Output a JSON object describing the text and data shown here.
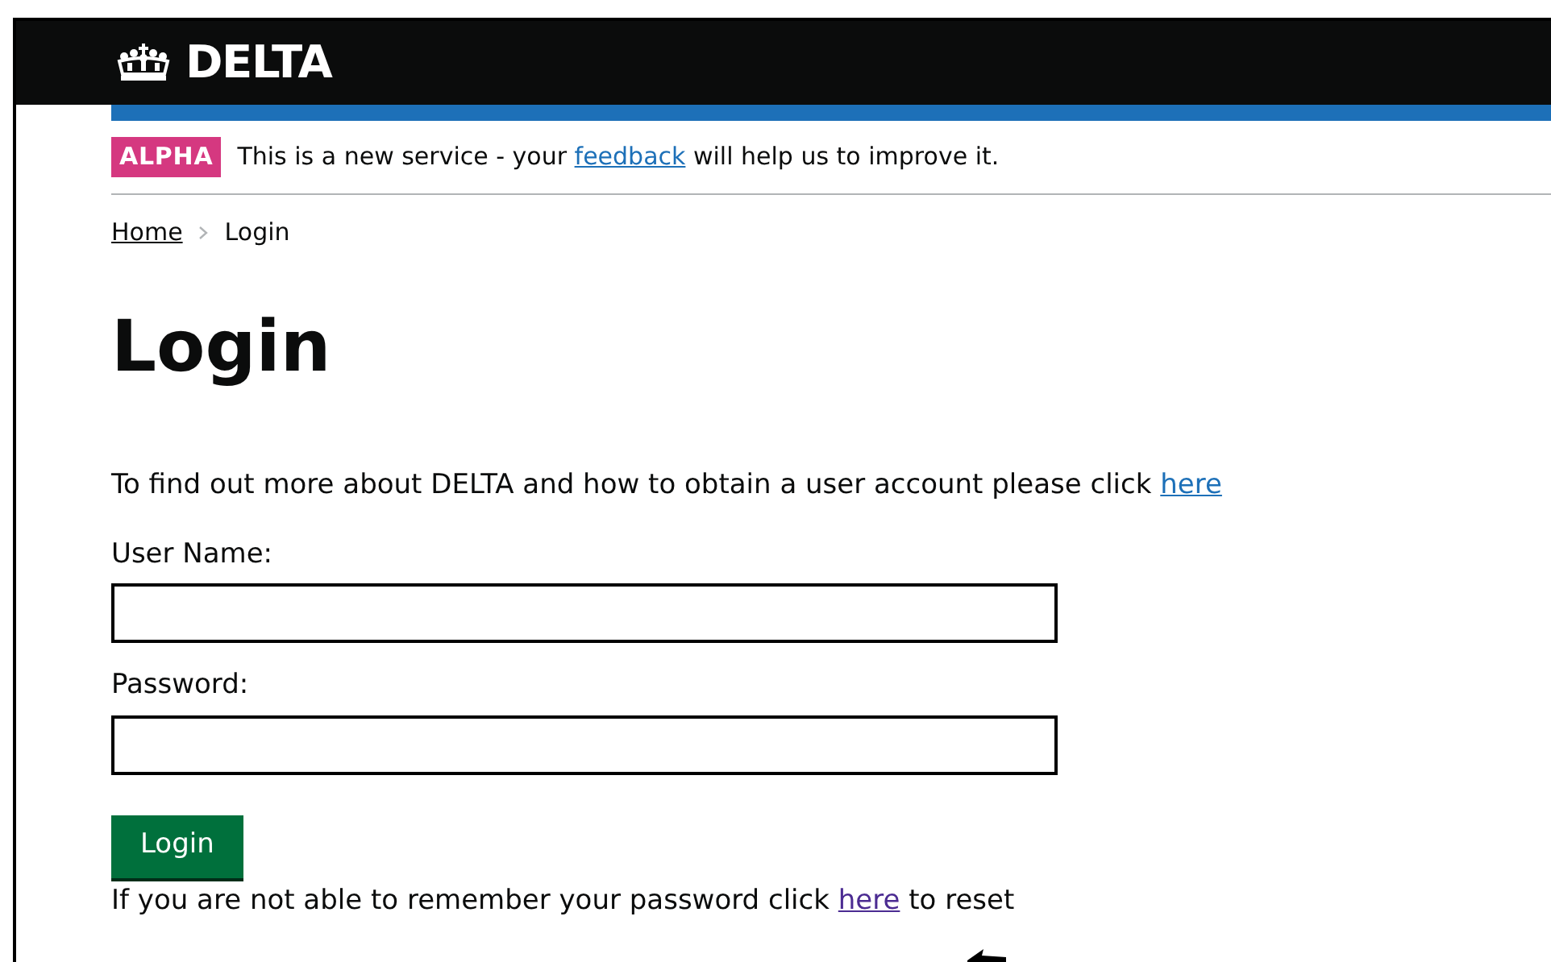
{
  "header": {
    "logo_text": "DELTA"
  },
  "phase_banner": {
    "tag": "ALPHA",
    "text_before": "This is a new service - your",
    "link": "feedback",
    "text_after": "will help us to improve it."
  },
  "breadcrumbs": [
    {
      "label": "Home",
      "kind": "link"
    },
    {
      "label": "Login",
      "kind": "current"
    }
  ],
  "title": "Login",
  "intro": {
    "text": "To find out more about DELTA and how to obtain a user account please click",
    "link": "here"
  },
  "fields": [
    {
      "label": "User Name:"
    },
    {
      "label": "Password:"
    }
  ],
  "login_button": "Login",
  "reset": {
    "text_before": "If you are not able to remember your password click",
    "link": "here",
    "text_after": "to reset"
  }
}
